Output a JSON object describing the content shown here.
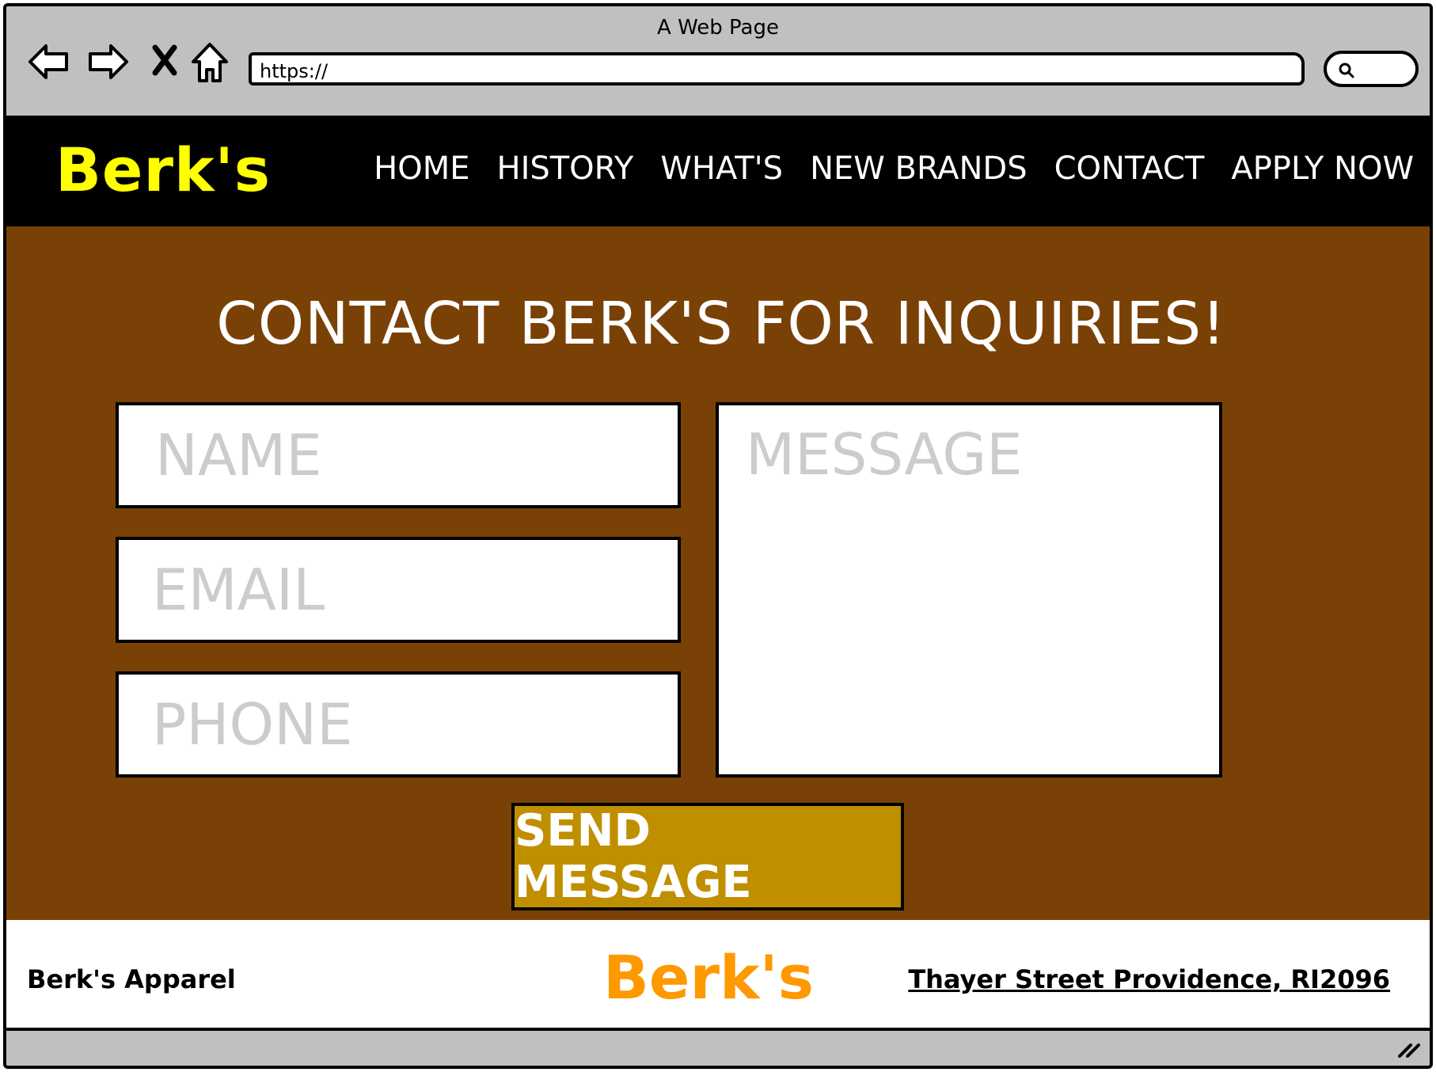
{
  "window": {
    "title": "A Web Page",
    "url": "https://"
  },
  "navbar": {
    "brand": "Berk's",
    "brand_color": "#ffff00",
    "links": [
      "HOME",
      "HISTORY",
      "WHAT'S",
      "NEW BRANDS",
      "CONTACT",
      "APPLY NOW"
    ]
  },
  "contact": {
    "heading": "CONTACT BERK'S FOR INQUIRIES!",
    "name_placeholder": "NAME",
    "email_placeholder": "EMAIL",
    "phone_placeholder": "PHONE",
    "message_placeholder": "MESSAGE",
    "send_label": "SEND MESSAGE",
    "background_color": "#7a4106",
    "button_color": "#bf8f00"
  },
  "footer": {
    "company": "Berk's Apparel",
    "brand": "Berk's",
    "brand_color": "#ff9900",
    "address": "Thayer Street Providence, RI2096"
  }
}
